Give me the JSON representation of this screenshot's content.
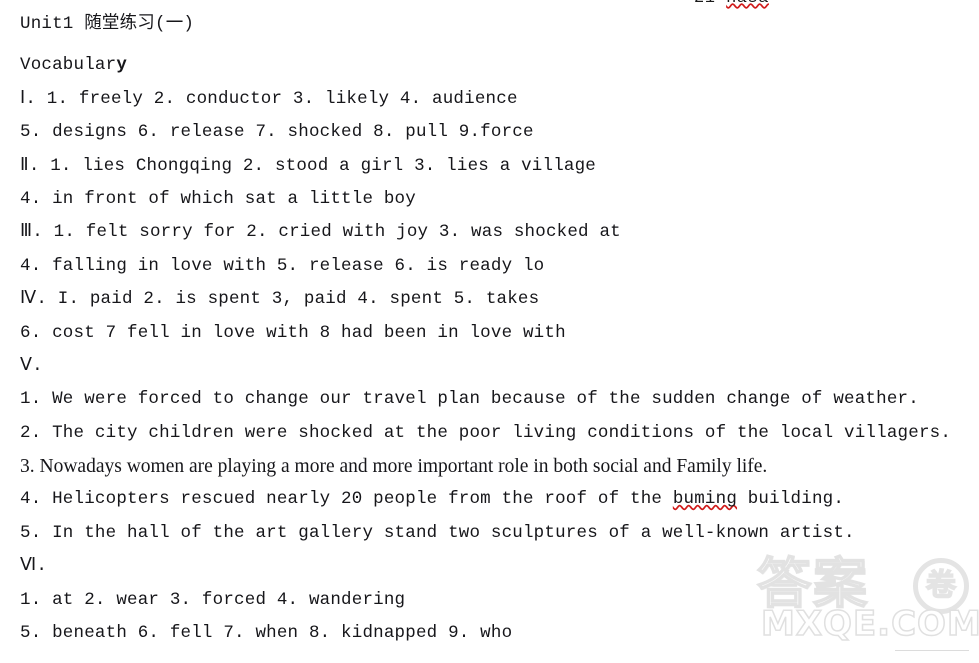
{
  "top_fragment": {
    "visible_text": "21 ",
    "misspelled_word": "nasa"
  },
  "document": {
    "title": "Unit1 随堂练习(一)",
    "subtitle_prefix": "Vocabular",
    "subtitle_tail": "y",
    "sections": [
      {
        "id": "section-1",
        "numeral": "Ⅰ.",
        "lines": [
          "Ⅰ. 1. freely 2. conductor 3. likely 4. audience",
          "5. designs 6. release 7. shocked 8. pull 9.force"
        ]
      },
      {
        "id": "section-2",
        "numeral": "Ⅱ.",
        "lines": [
          "Ⅱ. 1. lies Chongqing 2. stood a girl 3. lies a village",
          "4. in front of which sat a little boy"
        ]
      },
      {
        "id": "section-3",
        "numeral": "Ⅲ.",
        "lines": [
          "Ⅲ. 1. felt sorry for 2. cried with joy 3. was shocked at",
          "4. falling in love with 5. release 6. is ready lo"
        ]
      },
      {
        "id": "section-4",
        "numeral": "Ⅳ.",
        "lines": [
          "Ⅳ. I. paid 2. is spent 3, paid 4. spent 5. takes",
          "6. cost 7 fell in love with 8 had been in love with"
        ]
      },
      {
        "id": "section-5",
        "numeral": "Ⅴ.",
        "heading_line": "Ⅴ.",
        "sentences": [
          {
            "number": "1.",
            "text": "1. We were forced to change our travel plan because of the sudden change of weather.",
            "serif": false
          },
          {
            "number": "2.",
            "text": "2. The city children were shocked at the poor living conditions of the local villagers.",
            "serif": false
          },
          {
            "number": "3.",
            "text": "3. Nowadays women are playing a more and more important role in both social and Family life.",
            "serif": true
          },
          {
            "number": "4.",
            "prefix": "4. Helicopters rescued nearly 20 people from the roof of the ",
            "misspelled": "buming",
            "suffix": " building.",
            "serif": false
          },
          {
            "number": "5.",
            "text": "5. In the hall of the art gallery stand two sculptures of a well-known artist.",
            "serif": false
          }
        ]
      },
      {
        "id": "section-6",
        "numeral": "Ⅵ.",
        "heading_line": "Ⅵ.",
        "lines": [
          "1. at 2. wear 3. forced 4. wandering",
          "5. beneath 6. fell 7. when 8. kidnapped 9. who"
        ]
      }
    ]
  },
  "watermark": {
    "cjk_text": "答案",
    "circle_char": "卷",
    "domain": "MXQE.COM"
  }
}
